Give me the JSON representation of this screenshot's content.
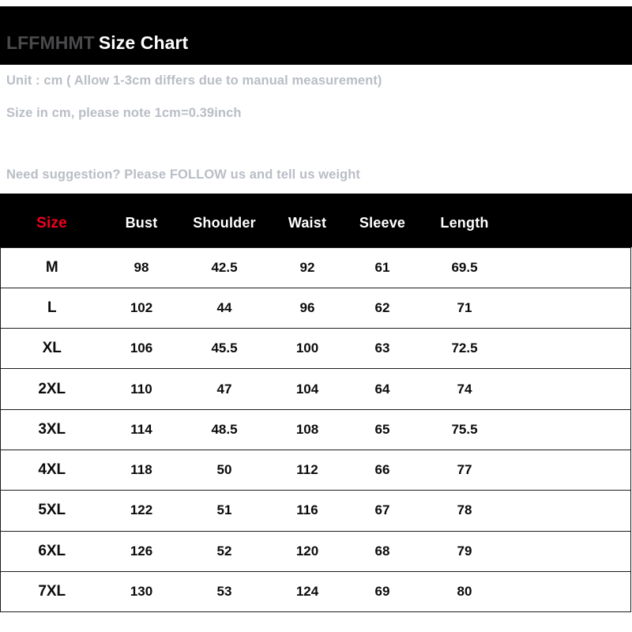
{
  "header": {
    "brand": "LFFMHMT",
    "title": "Size Chart"
  },
  "notes": {
    "line1": "Unit : cm ( Allow 1-3cm differs due to manual measurement)",
    "line2": "Size in cm, please note 1cm=0.39inch",
    "line3": "Need suggestion? Please FOLLOW us and tell us weight"
  },
  "colors": {
    "banner_background": "#000000",
    "brand_text": "#4a4a4d",
    "title_text": "#ffffff",
    "note_text": "#b9bdc5",
    "size_header_text": "#f3001c",
    "header_text": "#ffffff",
    "cell_text": "#0a0a0a",
    "table_border": "#1c1c1c"
  },
  "chart_data": {
    "type": "table",
    "title": "Size Chart",
    "unit": "cm",
    "columns": [
      "Size",
      "Bust",
      "Shoulder",
      "Waist",
      "Sleeve",
      "Length"
    ],
    "rows": [
      {
        "size": "M",
        "bust": "98",
        "shoulder": "42.5",
        "waist": "92",
        "sleeve": "61",
        "length": "69.5"
      },
      {
        "size": "L",
        "bust": "102",
        "shoulder": "44",
        "waist": "96",
        "sleeve": "62",
        "length": "71"
      },
      {
        "size": "XL",
        "bust": "106",
        "shoulder": "45.5",
        "waist": "100",
        "sleeve": "63",
        "length": "72.5"
      },
      {
        "size": "2XL",
        "bust": "110",
        "shoulder": "47",
        "waist": "104",
        "sleeve": "64",
        "length": "74"
      },
      {
        "size": "3XL",
        "bust": "114",
        "shoulder": "48.5",
        "waist": "108",
        "sleeve": "65",
        "length": "75.5"
      },
      {
        "size": "4XL",
        "bust": "118",
        "shoulder": "50",
        "waist": "112",
        "sleeve": "66",
        "length": "77"
      },
      {
        "size": "5XL",
        "bust": "122",
        "shoulder": "51",
        "waist": "116",
        "sleeve": "67",
        "length": "78"
      },
      {
        "size": "6XL",
        "bust": "126",
        "shoulder": "52",
        "waist": "120",
        "sleeve": "68",
        "length": "79"
      },
      {
        "size": "7XL",
        "bust": "130",
        "shoulder": "53",
        "waist": "124",
        "sleeve": "69",
        "length": "80"
      }
    ]
  }
}
